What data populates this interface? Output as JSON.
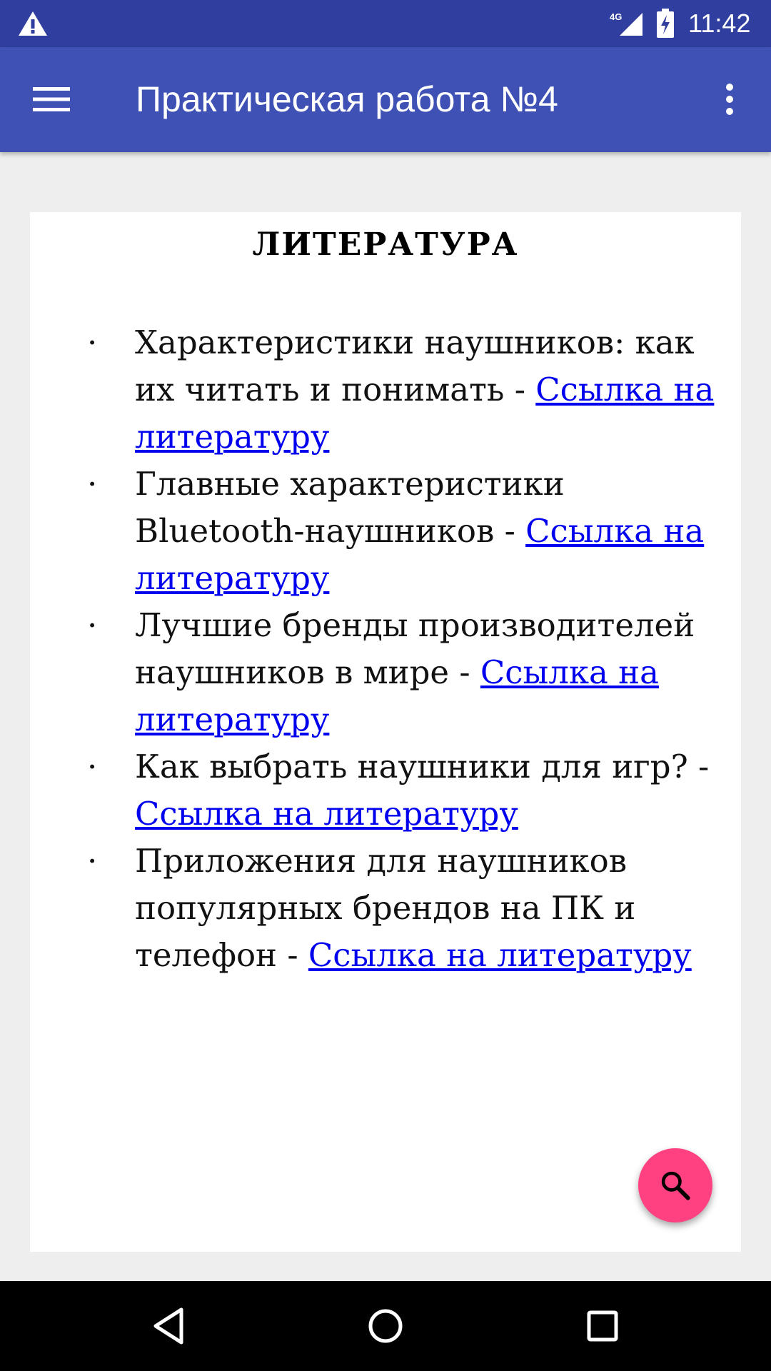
{
  "status_bar": {
    "time": "11:42",
    "network_label": "4G",
    "icons": [
      "warning-icon",
      "cellular-signal-icon",
      "battery-charging-icon"
    ]
  },
  "app_bar": {
    "title": "Практическая работа №4",
    "icons": [
      "hamburger-menu-icon",
      "more-vert-icon"
    ]
  },
  "content": {
    "heading": "ЛИТЕРАТУРА",
    "bullet": "·",
    "items": [
      {
        "text": "Характеристики наушников: как их читать и понимать - ",
        "link": "Ссылка на литературу"
      },
      {
        "text": "Главные характеристики Bluetooth-наушников - ",
        "link": "Ссылка на литературу"
      },
      {
        "text": "Лучшие бренды производителей наушников в мире - ",
        "link": "Ссылка на литературу"
      },
      {
        "text": "Как выбрать наушники для игр? - ",
        "link": "Ссылка на литературу"
      },
      {
        "text": "Приложения для наушников популярных брендов на ПК и телефон - ",
        "link": "Ссылка на литературу"
      }
    ]
  },
  "fab": {
    "icon": "search-icon"
  },
  "nav_bar": {
    "icons": [
      "back-triangle-icon",
      "home-circle-icon",
      "recents-square-icon"
    ]
  },
  "colors": {
    "status_bar": "#303f9f",
    "app_bar": "#3f51b5",
    "background": "#eeeeee",
    "card": "#ffffff",
    "link": "#0000ee",
    "fab": "#ff4081",
    "nav_bar": "#000000"
  }
}
